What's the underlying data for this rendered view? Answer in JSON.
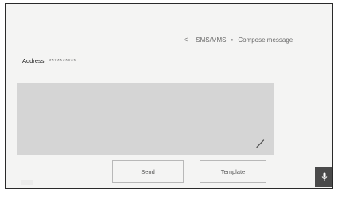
{
  "header": {
    "back_symbol": "<",
    "breadcrumb_parent": "SMS/MMS",
    "breadcrumb_separator": "•",
    "breadcrumb_current": "Compose message"
  },
  "address": {
    "label": "Address:",
    "value": "**********"
  },
  "message": {
    "body": "",
    "edit_icon": "pencil-icon"
  },
  "actions": {
    "send_label": "Send",
    "template_label": "Template",
    "mic_icon": "microphone-icon"
  },
  "colors": {
    "screen_bg": "#f4f4f3",
    "message_box_bg": "#d5d5d5",
    "mic_button_bg": "#4a4a4a",
    "border": "#2a2a2a"
  }
}
